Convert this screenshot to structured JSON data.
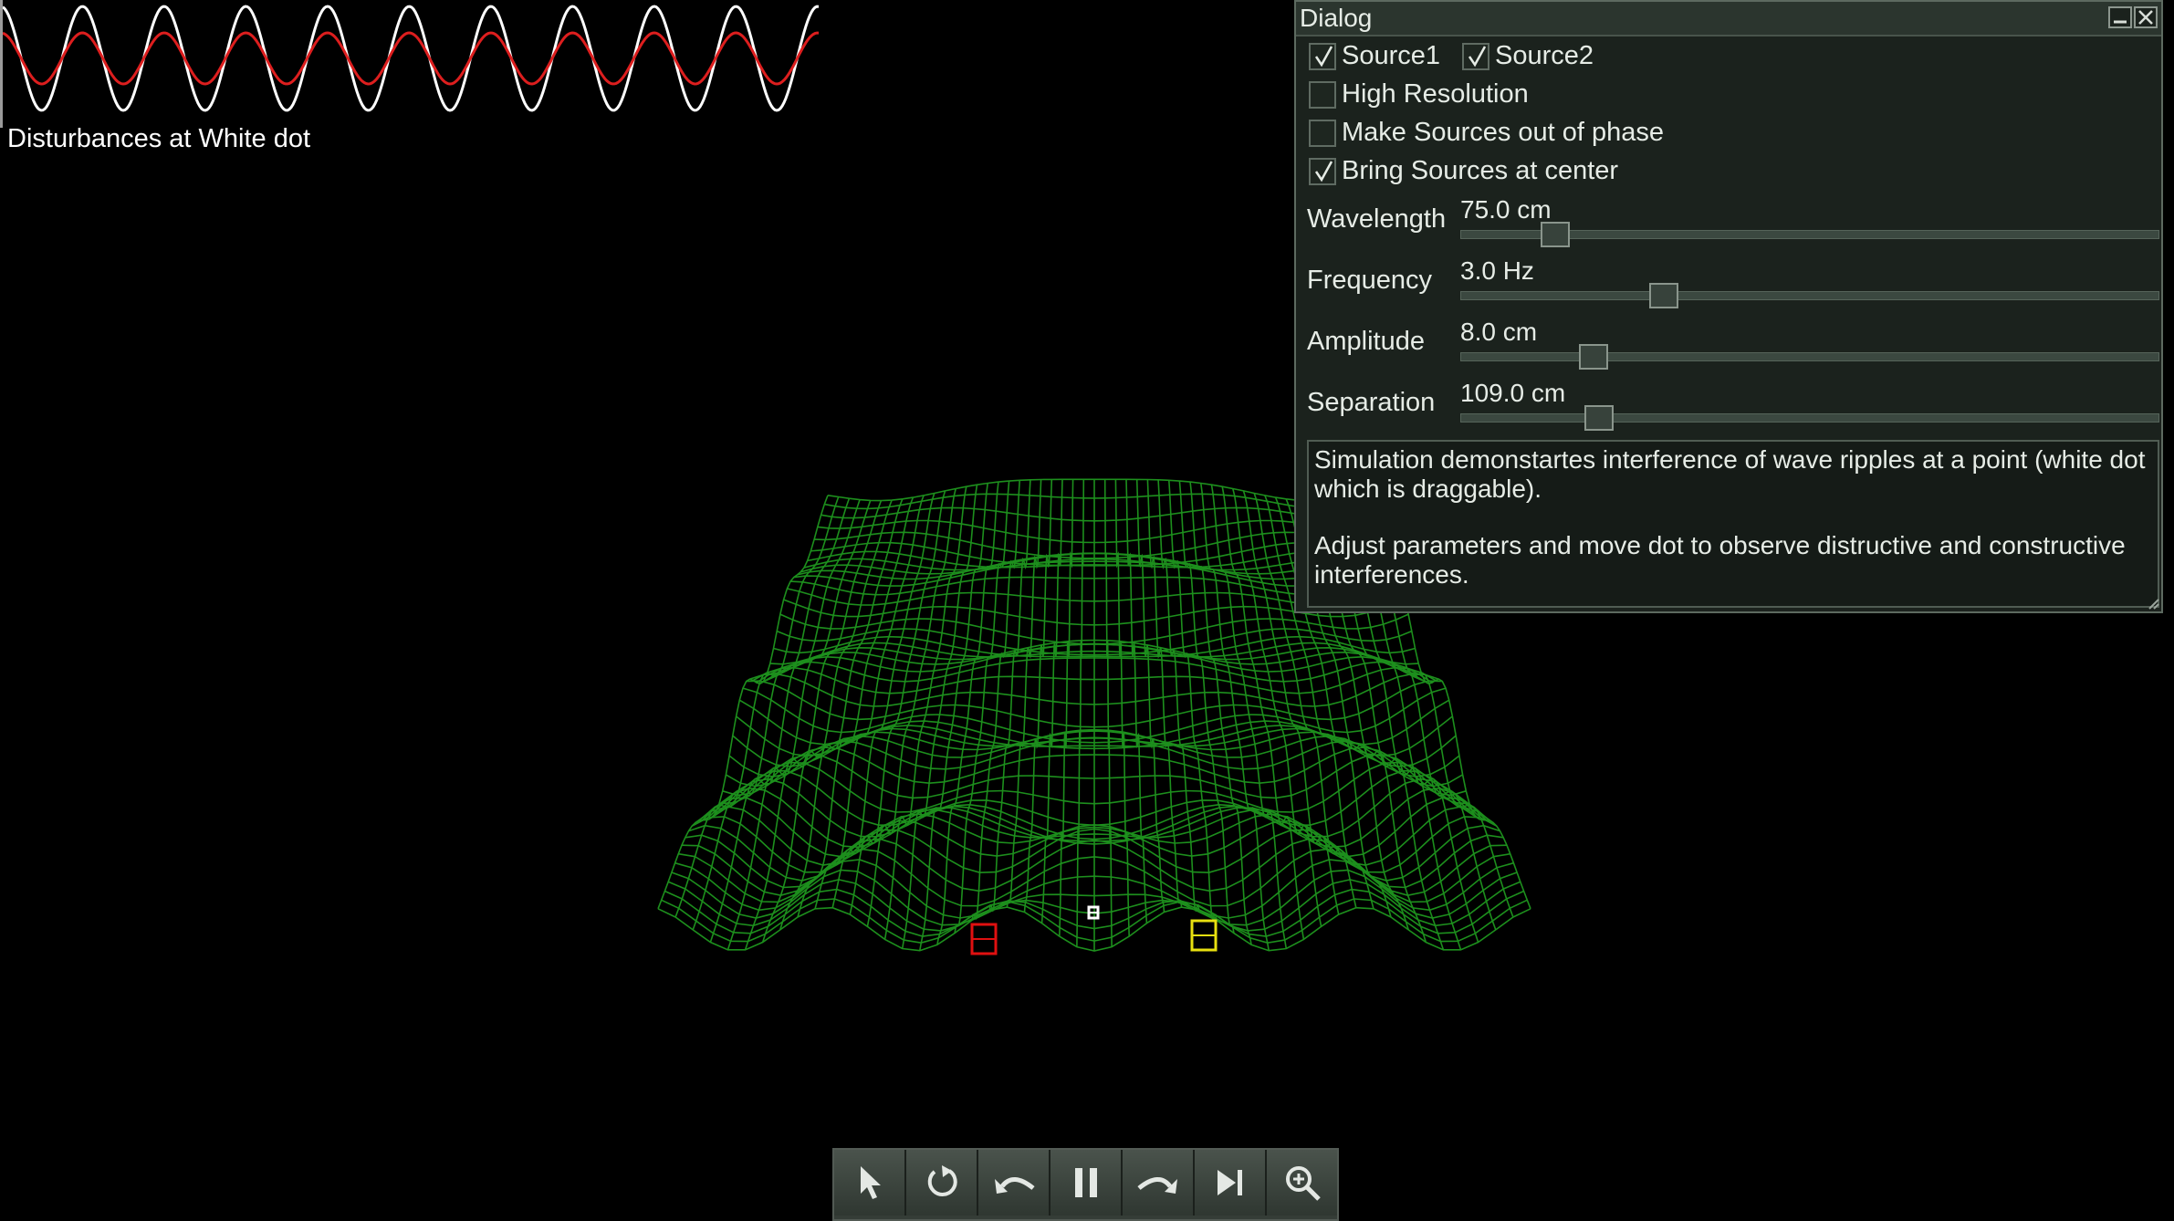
{
  "graph": {
    "label": "Disturbances at White dot",
    "colors": {
      "resultant": "#ffffff",
      "single": "#dd1e1e"
    }
  },
  "scene": {
    "mesh_color": "#1d8f1d",
    "source1_color": "#e01010",
    "source2_color": "#e8e010",
    "dot_color": "#ffffff"
  },
  "dialog": {
    "title": "Dialog",
    "minimize_icon": "minimize-icon",
    "close_icon": "close-icon",
    "checkboxes": {
      "source1": {
        "label": "Source1",
        "checked": true
      },
      "source2": {
        "label": "Source2",
        "checked": true
      },
      "high_res": {
        "label": "High Resolution",
        "checked": false
      },
      "out_of_phase": {
        "label": "Make Sources out of phase",
        "checked": false
      },
      "center": {
        "label": "Bring Sources at center",
        "checked": true
      }
    },
    "sliders": {
      "wavelength": {
        "label": "Wavelength",
        "value_text": "75.0 cm",
        "fraction": 0.135
      },
      "frequency": {
        "label": "Frequency",
        "value_text": "3.0 Hz",
        "fraction": 0.29
      },
      "amplitude": {
        "label": "Amplitude",
        "value_text": "8.0 cm",
        "fraction": 0.19
      },
      "separation": {
        "label": "Separation",
        "value_text": "109.0 cm",
        "fraction": 0.197
      }
    },
    "description": {
      "p1": "Simulation demonstartes interference of wave ripples at a point (white dot which is draggable).",
      "p2": "Adjust parameters and move dot to observe distructive and constructive interferences."
    }
  },
  "toolbar": {
    "tools": [
      "pointer-icon",
      "reset-icon",
      "undo-icon",
      "pause-icon",
      "redo-icon",
      "step-forward-icon",
      "zoom-icon"
    ]
  }
}
